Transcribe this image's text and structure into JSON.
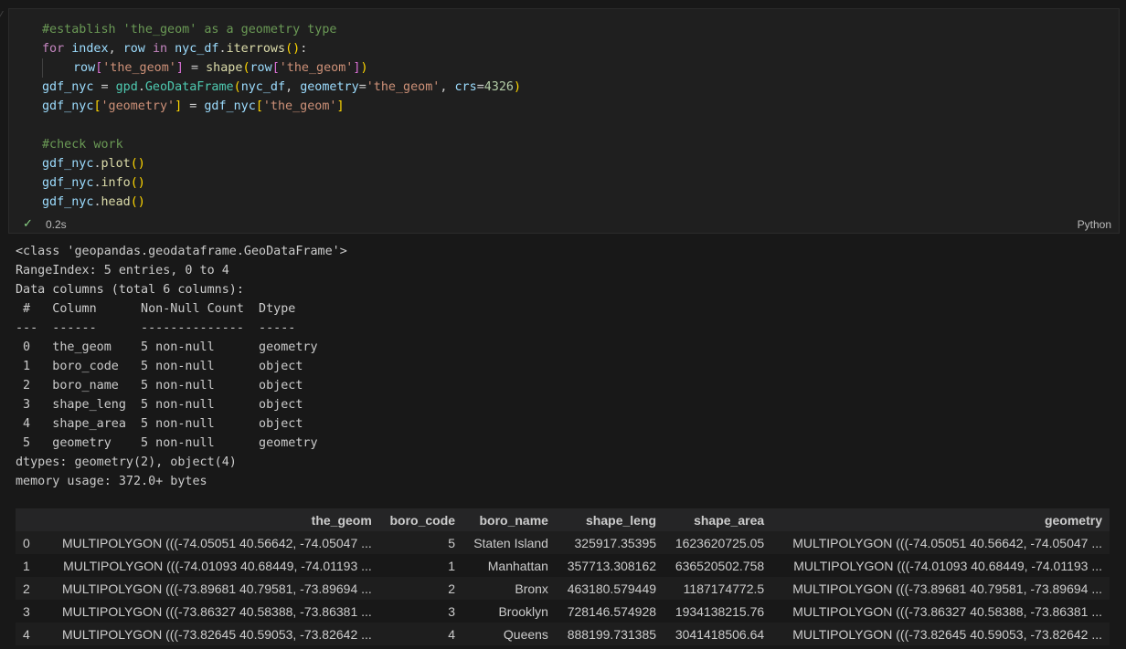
{
  "cell": {
    "language": "Python",
    "exec_time": "0.2s",
    "status_icon": "check-icon",
    "code_lines": [
      {
        "indent": 0,
        "tokens": [
          {
            "t": "#establish 'the_geom' as a geometry type",
            "c": "comment"
          }
        ]
      },
      {
        "indent": 0,
        "tokens": [
          {
            "t": "for",
            "c": "kw"
          },
          {
            "t": " ",
            "c": "plain"
          },
          {
            "t": "index",
            "c": "var"
          },
          {
            "t": ", ",
            "c": "plain"
          },
          {
            "t": "row",
            "c": "var"
          },
          {
            "t": " ",
            "c": "plain"
          },
          {
            "t": "in",
            "c": "kw"
          },
          {
            "t": " ",
            "c": "plain"
          },
          {
            "t": "nyc_df",
            "c": "var"
          },
          {
            "t": ".",
            "c": "plain"
          },
          {
            "t": "iterrows",
            "c": "fn"
          },
          {
            "t": "()",
            "c": "paren"
          },
          {
            "t": ":",
            "c": "plain"
          }
        ]
      },
      {
        "indent": 1,
        "tokens": [
          {
            "t": "row",
            "c": "var"
          },
          {
            "t": "[",
            "c": "brk"
          },
          {
            "t": "'the_geom'",
            "c": "str"
          },
          {
            "t": "]",
            "c": "brk"
          },
          {
            "t": " = ",
            "c": "plain"
          },
          {
            "t": "shape",
            "c": "fn"
          },
          {
            "t": "(",
            "c": "paren"
          },
          {
            "t": "row",
            "c": "var"
          },
          {
            "t": "[",
            "c": "brk"
          },
          {
            "t": "'the_geom'",
            "c": "str"
          },
          {
            "t": "]",
            "c": "brk"
          },
          {
            "t": ")",
            "c": "paren"
          }
        ]
      },
      {
        "indent": 0,
        "tokens": [
          {
            "t": "gdf_nyc",
            "c": "var"
          },
          {
            "t": " = ",
            "c": "plain"
          },
          {
            "t": "gpd",
            "c": "cls"
          },
          {
            "t": ".",
            "c": "plain"
          },
          {
            "t": "GeoDataFrame",
            "c": "cls"
          },
          {
            "t": "(",
            "c": "paren"
          },
          {
            "t": "nyc_df",
            "c": "var"
          },
          {
            "t": ", ",
            "c": "plain"
          },
          {
            "t": "geometry",
            "c": "var"
          },
          {
            "t": "=",
            "c": "plain"
          },
          {
            "t": "'the_geom'",
            "c": "str"
          },
          {
            "t": ", ",
            "c": "plain"
          },
          {
            "t": "crs",
            "c": "var"
          },
          {
            "t": "=",
            "c": "plain"
          },
          {
            "t": "4326",
            "c": "num"
          },
          {
            "t": ")",
            "c": "paren"
          }
        ]
      },
      {
        "indent": 0,
        "tokens": [
          {
            "t": "gdf_nyc",
            "c": "var"
          },
          {
            "t": "[",
            "c": "paren"
          },
          {
            "t": "'geometry'",
            "c": "str"
          },
          {
            "t": "]",
            "c": "paren"
          },
          {
            "t": " = ",
            "c": "plain"
          },
          {
            "t": "gdf_nyc",
            "c": "var"
          },
          {
            "t": "[",
            "c": "paren"
          },
          {
            "t": "'the_geom'",
            "c": "str"
          },
          {
            "t": "]",
            "c": "paren"
          }
        ]
      },
      {
        "indent": 0,
        "tokens": []
      },
      {
        "indent": 0,
        "tokens": [
          {
            "t": "#check work",
            "c": "comment"
          }
        ]
      },
      {
        "indent": 0,
        "tokens": [
          {
            "t": "gdf_nyc",
            "c": "var"
          },
          {
            "t": ".",
            "c": "plain"
          },
          {
            "t": "plot",
            "c": "fn"
          },
          {
            "t": "()",
            "c": "paren"
          }
        ]
      },
      {
        "indent": 0,
        "tokens": [
          {
            "t": "gdf_nyc",
            "c": "var"
          },
          {
            "t": ".",
            "c": "plain"
          },
          {
            "t": "info",
            "c": "fn"
          },
          {
            "t": "()",
            "c": "paren"
          }
        ]
      },
      {
        "indent": 0,
        "tokens": [
          {
            "t": "gdf_nyc",
            "c": "var"
          },
          {
            "t": ".",
            "c": "plain"
          },
          {
            "t": "head",
            "c": "fn"
          },
          {
            "t": "()",
            "c": "paren"
          }
        ]
      }
    ]
  },
  "output": {
    "info_lines": [
      "<class 'geopandas.geodataframe.GeoDataFrame'>",
      "RangeIndex: 5 entries, 0 to 4",
      "Data columns (total 6 columns):",
      " #   Column      Non-Null Count  Dtype   ",
      "---  ------      --------------  -----   ",
      " 0   the_geom    5 non-null      geometry",
      " 1   boro_code   5 non-null      object  ",
      " 2   boro_name   5 non-null      object  ",
      " 3   shape_leng  5 non-null      object  ",
      " 4   shape_area  5 non-null      object  ",
      " 5   geometry    5 non-null      geometry",
      "dtypes: geometry(2), object(4)",
      "memory usage: 372.0+ bytes"
    ]
  },
  "dataframe": {
    "columns": [
      "",
      "the_geom",
      "boro_code",
      "boro_name",
      "shape_leng",
      "shape_area",
      "geometry"
    ],
    "rows": [
      [
        "0",
        "MULTIPOLYGON (((-74.05051 40.56642, -74.05047 ...",
        "5",
        "Staten Island",
        "325917.35395",
        "1623620725.05",
        "MULTIPOLYGON (((-74.05051 40.56642, -74.05047 ..."
      ],
      [
        "1",
        "MULTIPOLYGON (((-74.01093 40.68449, -74.01193 ...",
        "1",
        "Manhattan",
        "357713.308162",
        "636520502.758",
        "MULTIPOLYGON (((-74.01093 40.68449, -74.01193 ..."
      ],
      [
        "2",
        "MULTIPOLYGON (((-73.89681 40.79581, -73.89694 ...",
        "2",
        "Bronx",
        "463180.579449",
        "1187174772.5",
        "MULTIPOLYGON (((-73.89681 40.79581, -73.89694 ..."
      ],
      [
        "3",
        "MULTIPOLYGON (((-73.86327 40.58388, -73.86381 ...",
        "3",
        "Brooklyn",
        "728146.574928",
        "1934138215.76",
        "MULTIPOLYGON (((-73.86327 40.58388, -73.86381 ..."
      ],
      [
        "4",
        "MULTIPOLYGON (((-73.82645 40.59053, -73.82642 ...",
        "4",
        "Queens",
        "888199.731385",
        "3041418506.64",
        "MULTIPOLYGON (((-73.82645 40.59053, -73.82642 ..."
      ]
    ]
  }
}
